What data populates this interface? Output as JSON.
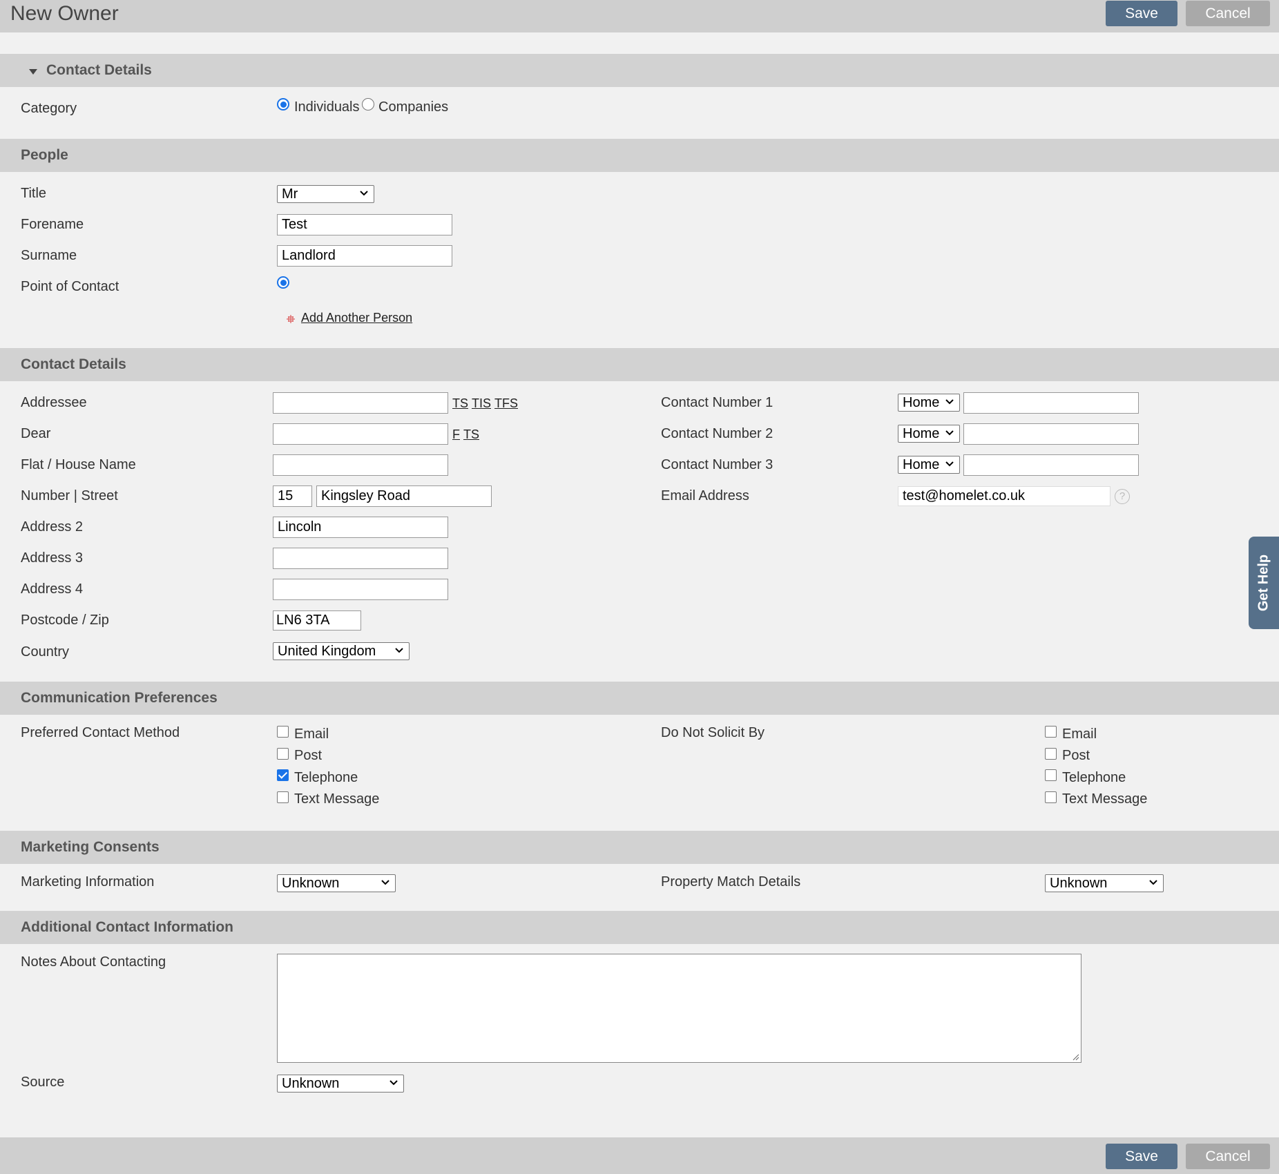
{
  "header": {
    "title": "New Owner",
    "save_label": "Save",
    "cancel_label": "Cancel"
  },
  "footer": {
    "save_label": "Save",
    "cancel_label": "Cancel"
  },
  "contact_details_top": {
    "title": "Contact Details",
    "category_label": "Category",
    "options": [
      "Individuals",
      "Companies"
    ],
    "selected": "Individuals"
  },
  "people": {
    "title": "People",
    "title_label": "Title",
    "title_value": "Mr",
    "forename_label": "Forename",
    "forename_value": "Test",
    "surname_label": "Surname",
    "surname_value": "Landlord",
    "point_of_contact_label": "Point of Contact",
    "add_person_label": "Add Another Person"
  },
  "contact_details": {
    "title": "Contact Details",
    "addressee_label": "Addressee",
    "addressee_value": "",
    "addressee_links": [
      "TS",
      "TIS",
      "TFS"
    ],
    "dear_label": "Dear",
    "dear_value": "",
    "dear_links": [
      "F",
      "TS"
    ],
    "flat_label": "Flat / House Name",
    "flat_value": "",
    "number_street_label": "Number | Street",
    "number_value": "15",
    "street_value": "Kingsley Road",
    "address2_label": "Address 2",
    "address2_value": "Lincoln",
    "address3_label": "Address 3",
    "address3_value": "",
    "address4_label": "Address 4",
    "address4_value": "",
    "postcode_label": "Postcode / Zip",
    "postcode_value": "LN6 3TA",
    "country_label": "Country",
    "country_value": "United Kingdom",
    "contact1_label": "Contact Number 1",
    "contact1_type": "Home",
    "contact1_value": "",
    "contact2_label": "Contact Number 2",
    "contact2_type": "Home",
    "contact2_value": "",
    "contact3_label": "Contact Number 3",
    "contact3_type": "Home",
    "contact3_value": "",
    "email_label": "Email Address",
    "email_value": "test@homelet.co.uk",
    "help_glyph": "?"
  },
  "communication": {
    "title": "Communication Preferences",
    "preferred_label": "Preferred Contact Method",
    "preferred_options": [
      {
        "label": "Email",
        "checked": false
      },
      {
        "label": "Post",
        "checked": false
      },
      {
        "label": "Telephone",
        "checked": true
      },
      {
        "label": "Text Message",
        "checked": false
      }
    ],
    "solicit_label": "Do Not Solicit By",
    "solicit_options": [
      {
        "label": "Email",
        "checked": false
      },
      {
        "label": "Post",
        "checked": false
      },
      {
        "label": "Telephone",
        "checked": false
      },
      {
        "label": "Text Message",
        "checked": false
      }
    ]
  },
  "marketing": {
    "title": "Marketing Consents",
    "info_label": "Marketing Information",
    "info_value": "Unknown",
    "property_label": "Property Match Details",
    "property_value": "Unknown"
  },
  "additional": {
    "title": "Additional Contact Information",
    "notes_label": "Notes About Contacting",
    "notes_value": "",
    "source_label": "Source",
    "source_value": "Unknown"
  },
  "get_help": {
    "label": "Get Help"
  },
  "colors": {
    "primary_button": "#56708a",
    "secondary_button": "#a9a9a9",
    "band": "#d2d2d2",
    "background": "#f1f1f1",
    "radio_accent": "#1a73e8"
  }
}
